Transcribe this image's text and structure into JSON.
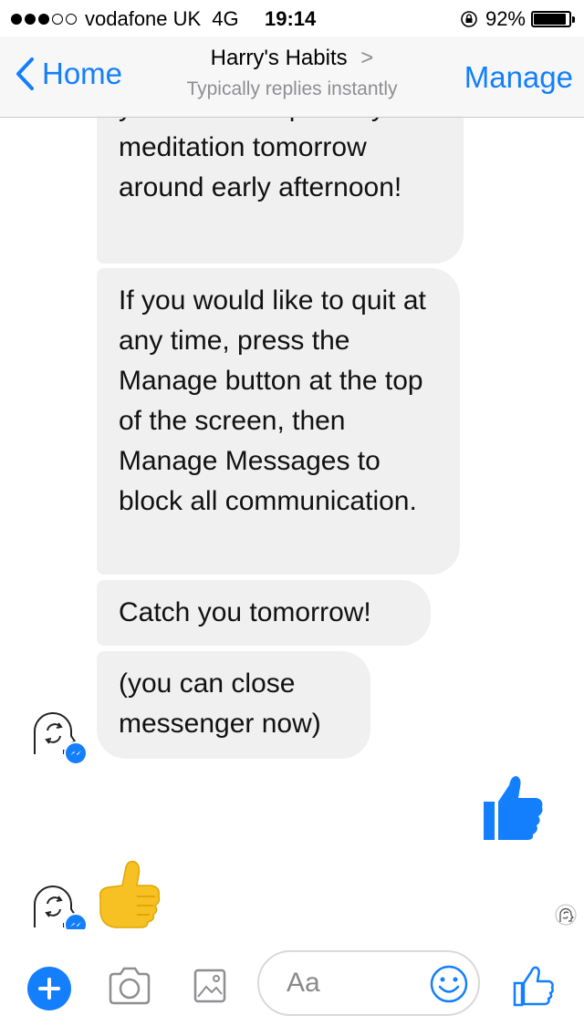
{
  "status_bar": {
    "carrier": "vodafone UK",
    "network": "4G",
    "time": "19:14",
    "battery": "92%",
    "battery_level": 0.92,
    "signal_bars_filled": 3,
    "signal_bars_total": 5
  },
  "nav": {
    "back_label": "Home",
    "title": "Harry's Habits",
    "title_chevron": ">",
    "subtitle": "Typically replies instantly",
    "manage_label": "Manage"
  },
  "messages": [
    {
      "text": "you have completed your meditation tomorrow around early afternoon!"
    },
    {
      "text": "If you would like to quit at any time, press the Manage button at the top of the screen, then Manage Messages to block all communication."
    },
    {
      "text": "Catch you tomorrow!"
    },
    {
      "text": "(you can close messenger now)"
    }
  ],
  "composer": {
    "placeholder": "Aa"
  },
  "colors": {
    "accent": "#137ffd",
    "bubble": "#f0f0f0",
    "emoji_yellow": "#f7c023"
  },
  "icons": {
    "back": "chevron-left-icon",
    "add": "plus-icon",
    "camera": "camera-icon",
    "gallery": "image-icon",
    "emoji": "smiley-icon",
    "like": "thumbs-up-icon",
    "bot_avatar": "habit-loop-avatar-icon",
    "messenger_badge": "messenger-icon"
  }
}
